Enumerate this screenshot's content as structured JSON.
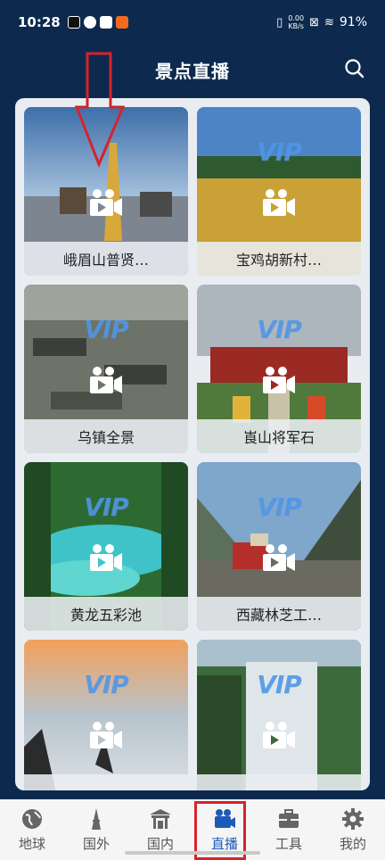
{
  "status_bar": {
    "time": "10:28",
    "speed_top": "0.00",
    "speed_bottom": "KB/s",
    "battery": "91%"
  },
  "header": {
    "title": "景点直播"
  },
  "vip_text": "VIP",
  "cards": [
    {
      "label": "峨眉山普贤…",
      "show_vip": false
    },
    {
      "label": "宝鸡胡新村…",
      "show_vip": true
    },
    {
      "label": "乌镇全景",
      "show_vip": true
    },
    {
      "label": "崀山将军石",
      "show_vip": true
    },
    {
      "label": "黄龙五彩池",
      "show_vip": true
    },
    {
      "label": "西藏林芝工…",
      "show_vip": true
    },
    {
      "label": "",
      "show_vip": true
    },
    {
      "label": "",
      "show_vip": true
    }
  ],
  "tabs": [
    {
      "label": "地球",
      "icon": "globe-icon"
    },
    {
      "label": "国外",
      "icon": "tower-icon"
    },
    {
      "label": "国内",
      "icon": "gate-icon"
    },
    {
      "label": "直播",
      "icon": "video-camera-icon"
    },
    {
      "label": "工具",
      "icon": "toolbox-icon"
    },
    {
      "label": "我的",
      "icon": "gear-icon"
    }
  ],
  "colors": {
    "background": "#0d2a4e",
    "active_tab": "#1e5bb8",
    "annotation_red": "#d6232a"
  }
}
